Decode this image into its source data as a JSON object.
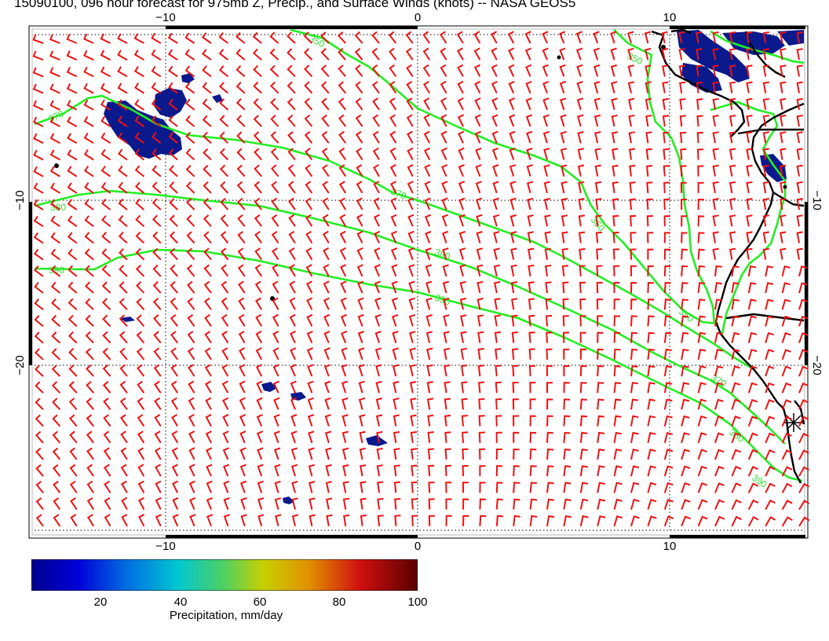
{
  "title": "15090100, 096 hour forecast for 975mb Z, Precip., and Surface Winds (knots) -- NASA GEOS5",
  "axes": {
    "top_ticks": [
      "−10",
      "0",
      "10"
    ],
    "bottom_ticks": [
      "−10",
      "0",
      "10"
    ],
    "left_ticks": [
      "−10",
      "−20"
    ],
    "right_ticks": [
      "−10",
      "−20"
    ]
  },
  "contour_labels": [
    "350",
    "360",
    "370",
    "380",
    "390"
  ],
  "colors": {
    "contour": "#22ee22",
    "barb": "#ee1111",
    "precip_fill": "#0a1a8c",
    "coast": "#000000"
  },
  "colorbar": {
    "label": "Precipitation, mm/day",
    "ticks": [
      "20",
      "40",
      "60",
      "80",
      "100"
    ],
    "range": [
      5,
      100
    ]
  }
}
